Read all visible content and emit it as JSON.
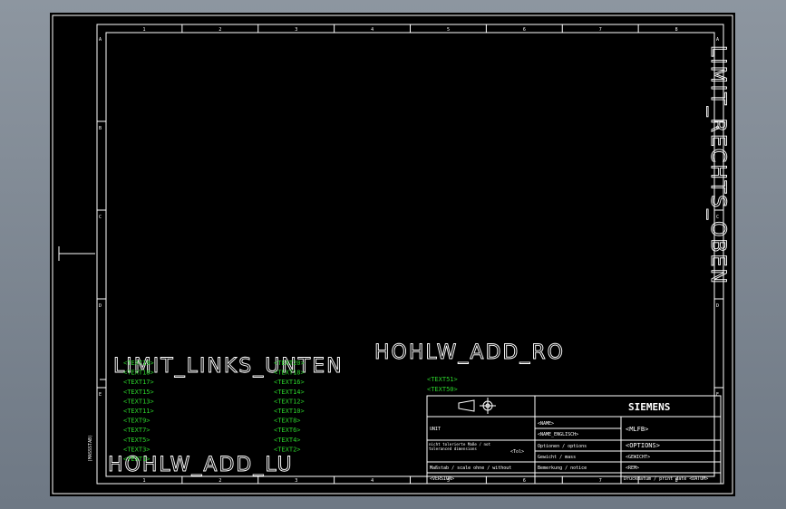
{
  "frame": {
    "columns": [
      "1",
      "2",
      "3",
      "4",
      "5",
      "6",
      "7",
      "8"
    ],
    "rows": [
      "A",
      "B",
      "C",
      "D",
      "E"
    ],
    "side_label": "(MASSSTAB)"
  },
  "big_texts": {
    "right_vertical": "LIMIT_RECHTS_OBEN",
    "left_bottom": "LIMIT_LINKS_UNTEN",
    "add_ro": "HOHLW_ADD_RO",
    "add_lu": "HOHLW_ADD_LU"
  },
  "text_columns": {
    "left": [
      "<TEXT19>",
      "<TEXT18>",
      "<TEXT17>",
      "<TEXT15>",
      "<TEXT13>",
      "<TEXT11>",
      "<TEXT9>",
      "<TEXT7>",
      "<TEXT5>",
      "<TEXT3>",
      "<TEXT1>"
    ],
    "right": [
      "<TEXT20>",
      "<TEXT18>",
      "<TEXT16>",
      "<TEXT14>",
      "<TEXT12>",
      "<TEXT10>",
      "<TEXT8>",
      "<TEXT6>",
      "<TEXT4>",
      "<TEXT2>"
    ],
    "extra": [
      "<TEXT51>",
      "<TEXT50>"
    ]
  },
  "title_block": {
    "brand": "SIEMENS",
    "unit": "UNIT",
    "name": "<NAME>",
    "name_english": "<NAME_ENGLISCH>",
    "mlfb": "<MLFB>",
    "tolerance": "nicht tolerierte Maße / not toleranced dimensions",
    "tolerance_value": "<Tol>",
    "options_label": "Optionen / options",
    "options_value": "<OPTIONS>",
    "weight_label": "Gewicht / mass",
    "weight_value": "<GEWICHT>",
    "remark_label": "Bemerkung / notice",
    "remark_value": "<REM>",
    "scale_label": "Maßstab / scale  ohne / without",
    "version": "<VERSION>",
    "date_label": "Druckdatum / print date <DATUM>"
  }
}
